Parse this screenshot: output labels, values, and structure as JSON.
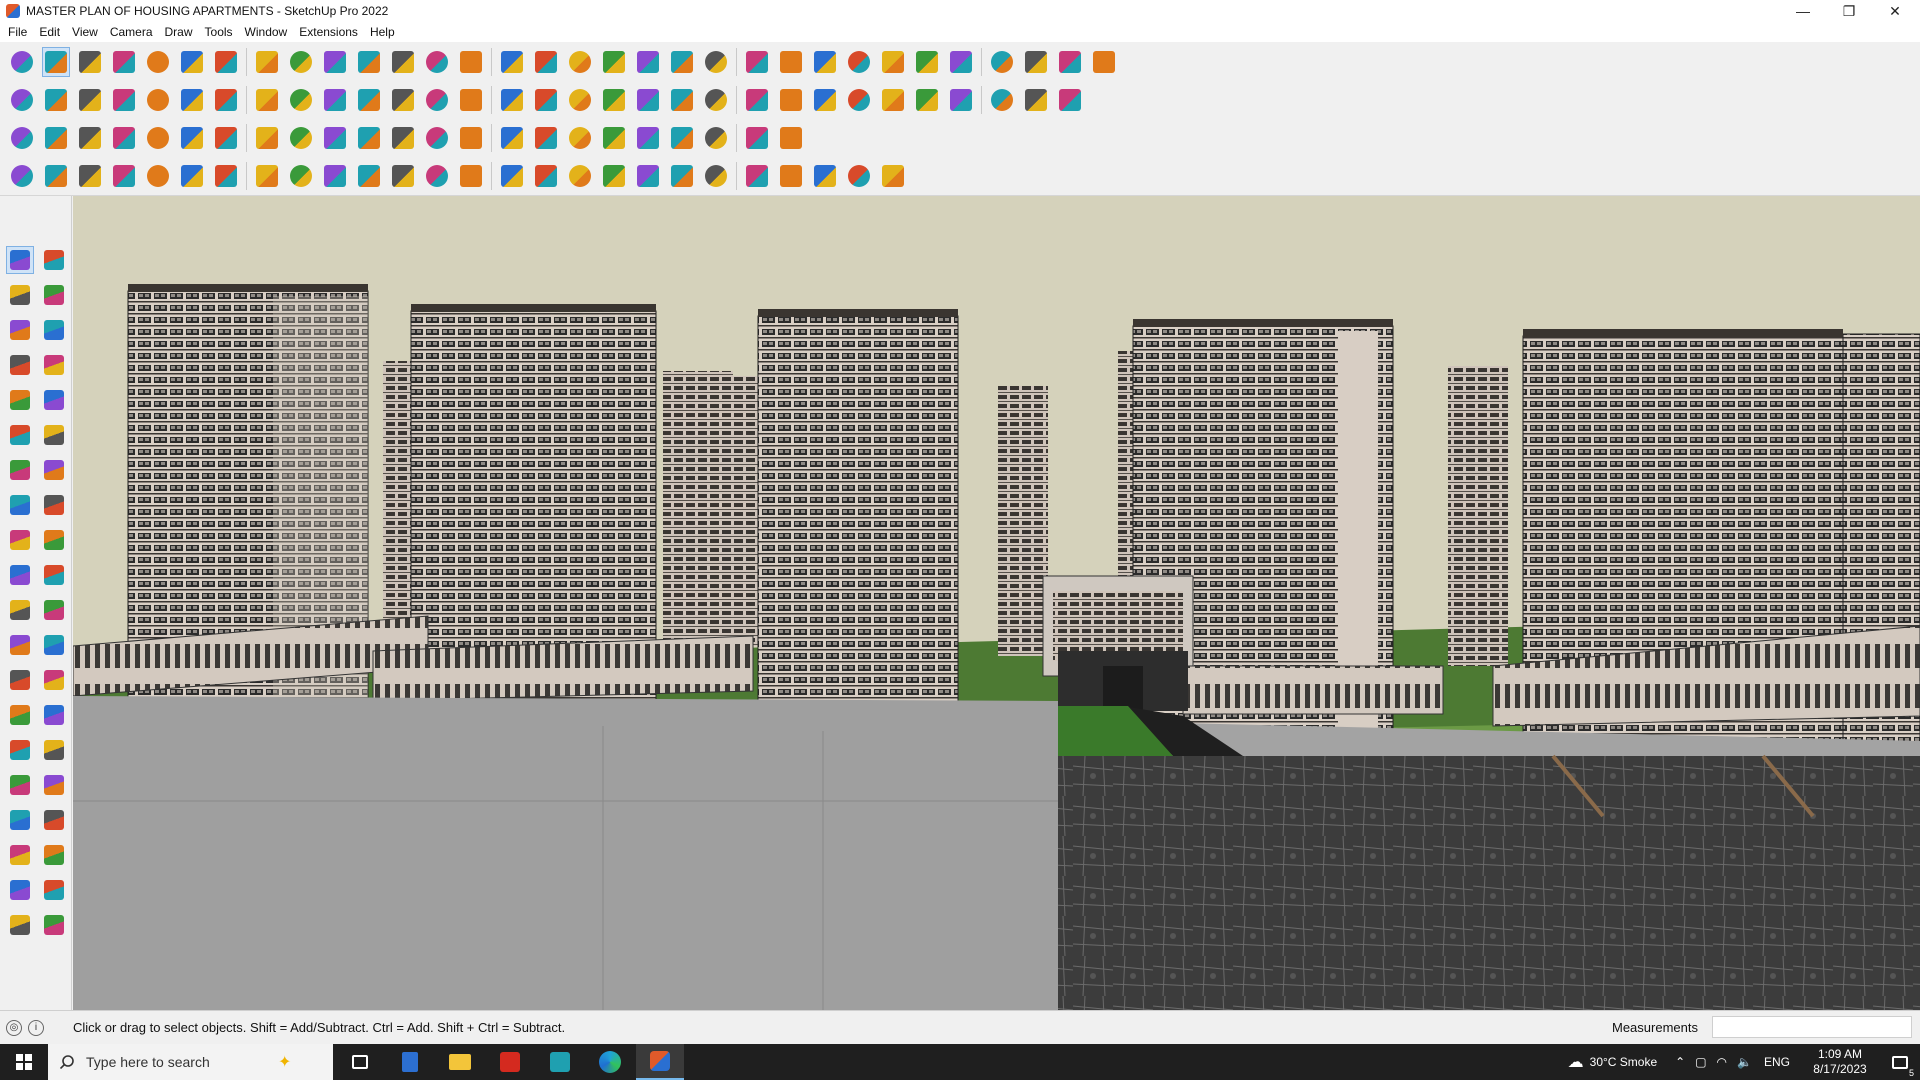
{
  "window": {
    "title": "MASTER PLAN OF HOUSING APARTMENTS - SketchUp Pro 2022",
    "controls": {
      "minimize": "—",
      "restore": "❐",
      "close": "✕"
    }
  },
  "menu": [
    "File",
    "Edit",
    "View",
    "Camera",
    "Draw",
    "Tools",
    "Window",
    "Extensions",
    "Help"
  ],
  "toolbar": {
    "row1": [
      "zoom-icon",
      "select-icon",
      "eraser-icon",
      "line-icon",
      "arc-icon",
      "rectangle-icon",
      "push-pull-icon",
      "follow-me-icon",
      "move-icon",
      "rotate-icon",
      "scale-icon",
      "tape-measure-icon",
      "text-icon",
      "paint-bucket-icon",
      "orbit-icon",
      "pan-icon",
      "zoom-window-icon",
      "zoom-extents-icon",
      "styles-icon",
      "section-plane-icon",
      "layers-icon",
      "sandbox-icon",
      "camera-icon",
      "solid-union-icon",
      "solid-subtract-icon",
      "shadow-icon",
      "walk-icon",
      "look-around-icon",
      "position-camera-icon",
      "undo-icon",
      "redo-icon",
      "extension-icon"
    ],
    "row2": [
      "iso-view-icon",
      "top-view-icon",
      "front-view-icon",
      "push-pull-icon",
      "move-icon",
      "rotate-icon",
      "scale-icon",
      "follow-me-icon",
      "offset-icon",
      "intersect-icon",
      "outer-shell-icon",
      "trim-icon",
      "split-icon",
      "roof-icon",
      "wall-icon",
      "window-icon",
      "door-icon",
      "house-icon",
      "stair-icon",
      "curve-icon",
      "shape-icon",
      "bezier-icon",
      "polygon-icon",
      "circle-icon",
      "ellipse-icon",
      "parallelogram-icon",
      "arc-tool-icon",
      "spiral-icon",
      "freehand-icon",
      "loft-icon",
      "material-icon"
    ],
    "row3": [
      "face-icon",
      "plane-icon",
      "box-icon",
      "red-tool-icon",
      "fillet-icon",
      "chamfer-icon",
      "frame-icon",
      "extrude-icon",
      "joint-icon",
      "curve-edit-icon",
      "axis-icon",
      "explode-icon",
      "cone-icon",
      "pyramid-icon",
      "lathe-icon",
      "knot-icon",
      "loop-icon",
      "sweep-icon",
      "mesh-icon",
      "subdivide-icon",
      "grid-icon",
      "array-icon",
      "component-icon"
    ],
    "row4": [
      "weld-icon",
      "polyline-icon",
      "arrow-tool-icon",
      "loft-tool-icon",
      "bend-icon",
      "twist-icon",
      "shell-icon",
      "stretch-icon",
      "taper-icon",
      "flatten-icon",
      "shear-icon",
      "sculpt-icon",
      "spring-icon",
      "leaf-icon",
      "stairs-icon",
      "railing-icon",
      "hatch-icon",
      "pattern-icon",
      "terrain-icon",
      "fence-icon",
      "roof-tile-icon",
      "brick-icon",
      "louvre-icon",
      "column-icon",
      "truss-icon",
      "gear-icon"
    ]
  },
  "left_tools": [
    "select",
    "orbit",
    "paint-bucket",
    "eraser",
    "component",
    "tape-measure",
    "line",
    "freehand",
    "rectangle",
    "rotated-rectangle",
    "circle",
    "polygon",
    "arc",
    "pie",
    "two-point-arc",
    "three-point-arc",
    "move",
    "push-pull",
    "rotate",
    "follow-me",
    "scale",
    "offset",
    "tape",
    "text",
    "protractor",
    "axes",
    "dimension",
    "3d-text",
    "orbit-view",
    "pan",
    "zoom",
    "zoom-window",
    "zoom-extents",
    "previous",
    "position-camera",
    "look-around",
    "walk",
    "section-plane",
    "styles",
    "layers"
  ],
  "status": {
    "hint": "Click or drag to select objects. Shift = Add/Subtract. Ctrl = Add. Shift + Ctrl = Subtract.",
    "measurements_label": "Measurements",
    "measurements_value": ""
  },
  "taskbar": {
    "search_placeholder": "Type here to search",
    "weather": "30°C  Smoke",
    "language": "ENG",
    "time": "1:09 AM",
    "date": "8/17/2023",
    "notification_count": "5"
  },
  "colors": {
    "sky": "#d5d2bb",
    "building_facade": "#d8cfc6",
    "balcony_dark": "#2a2a2a",
    "lawn": "#3d7a2a",
    "road": "#9a9a9a"
  }
}
